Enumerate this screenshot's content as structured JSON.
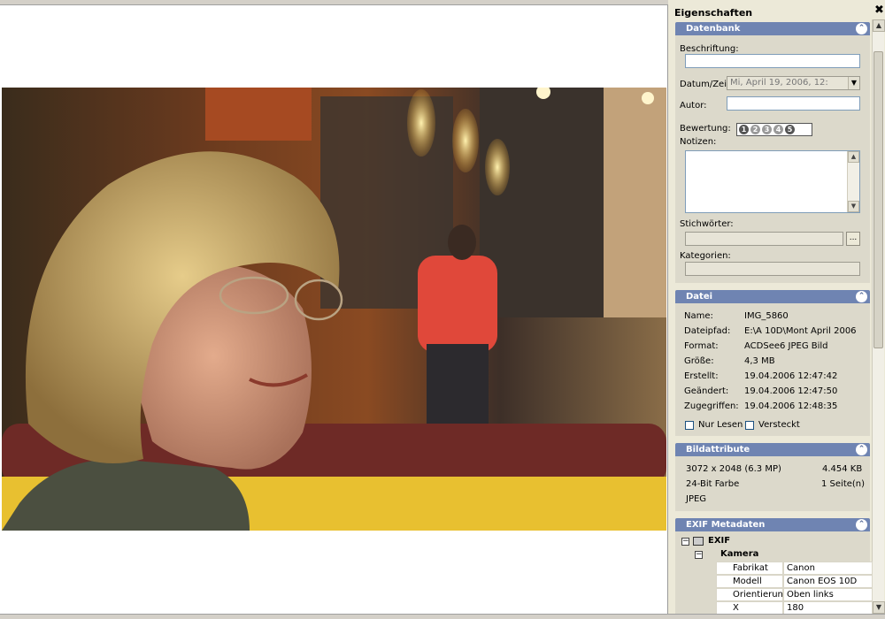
{
  "panel": {
    "title": "Eigenschaften",
    "close_glyph": "✖",
    "colors": {
      "header": "#6f84b2",
      "body": "#dcd9cb",
      "border": "#7f9db9"
    }
  },
  "datenbank": {
    "title": "Datenbank",
    "beschriftung_label": "Beschriftung:",
    "beschriftung_value": "",
    "datum_label": "Datum/Zeit:",
    "datum_value": "Mi,      April      19, 2006, 12:",
    "autor_label": "Autor:",
    "autor_value": "",
    "bewertung_label": "Bewertung:",
    "rating": [
      "1",
      "2",
      "3",
      "4",
      "5"
    ],
    "rating_value": 0,
    "notizen_label": "Notizen:",
    "stichwoerter_label": "Stichwörter:",
    "browse_label": "...",
    "kategorien_label": "Kategorien:"
  },
  "datei": {
    "title": "Datei",
    "rows": [
      {
        "k": "Name:",
        "v": "IMG_5860"
      },
      {
        "k": "Dateipfad:",
        "v": "E:\\A 10D\\Mont April 2006"
      },
      {
        "k": "Format:",
        "v": "ACDSee6 JPEG Bild"
      },
      {
        "k": "Größe:",
        "v": "4,3 MB"
      },
      {
        "k": "Erstellt:",
        "v": "19.04.2006 12:47:42"
      },
      {
        "k": "Geändert:",
        "v": "19.04.2006 12:47:50"
      },
      {
        "k": "Zugegriffen:",
        "v": "19.04.2006 12:48:35"
      }
    ],
    "nur_lesen": "Nur Lesen",
    "versteckt": "Versteckt"
  },
  "bildattribute": {
    "title": "Bildattribute",
    "dims": "3072 x 2048 (6.3 MP)",
    "size": "4.454 KB",
    "color": "24-Bit Farbe",
    "pages": "1 Seite(n)",
    "format": "JPEG"
  },
  "exif": {
    "title": "EXIF Metadaten",
    "root": "EXIF",
    "group": "Kamera",
    "rows": [
      {
        "k": "Fabrikat",
        "v": "Canon",
        "icon": "pencil-icon"
      },
      {
        "k": "Modell",
        "v": "Canon EOS 10D",
        "icon": "pencil-icon"
      },
      {
        "k": "Orientierung",
        "v": "Oben links",
        "icon": ""
      },
      {
        "k": "X Auflösung",
        "v": "180",
        "icon": ""
      }
    ]
  }
}
